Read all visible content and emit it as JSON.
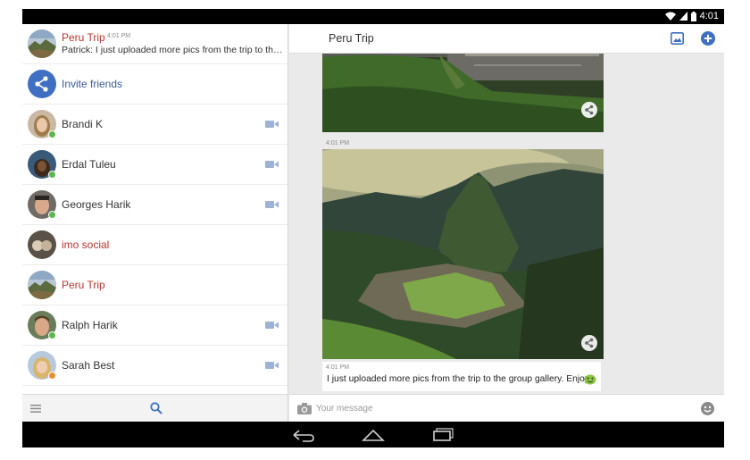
{
  "status_bar": {
    "time": "4:01"
  },
  "conversations": {
    "top_item": {
      "title": "Peru Trip",
      "time": "4:01 PM",
      "preview": "Patrick: I just uploaded more pics from the trip to the group gallery. Enjoy!"
    },
    "invite_label": "Invite friends",
    "contacts": [
      {
        "name": "Brandi K"
      },
      {
        "name": "Erdal Tuleu"
      },
      {
        "name": "Georges Harik"
      },
      {
        "name": "imo social"
      },
      {
        "name": "Peru Trip"
      },
      {
        "name": "Ralph Harik"
      },
      {
        "name": "Sarah Best"
      }
    ]
  },
  "chat": {
    "title": "Peru Trip",
    "photo_timestamp": "4:01 PM",
    "message": {
      "timestamp": "4:01 PM",
      "text": "I just uploaded more pics from the trip to the group gallery. Enjoy!"
    },
    "composer_placeholder": "Your message"
  },
  "colors": {
    "accent": "#3f6fc3",
    "group_name": "#b7352f",
    "online": "#5cb84e",
    "away": "#e8902f"
  },
  "icons": [
    "wifi-icon",
    "signal-icon",
    "battery-icon",
    "share-icon",
    "video-call-icon",
    "menu-icon",
    "search-icon",
    "gallery-icon",
    "add-icon",
    "camera-icon",
    "emoji-icon",
    "back-icon",
    "home-icon",
    "recents-icon"
  ]
}
